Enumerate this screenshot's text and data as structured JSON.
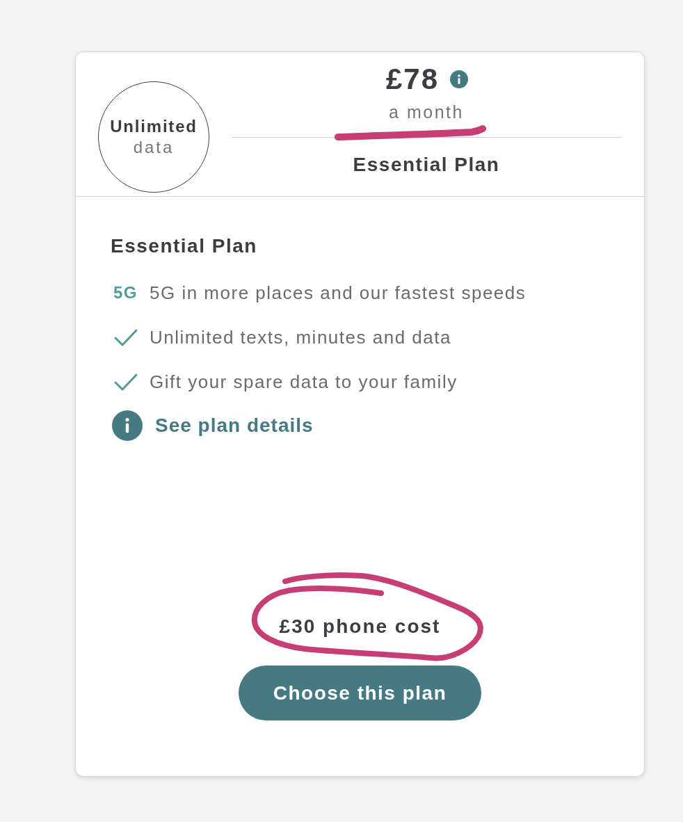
{
  "plan_card": {
    "header": {
      "data_badge": {
        "amount": "Unlimited",
        "unit": "data"
      },
      "price": "£78",
      "period": {
        "text": "a month",
        "underlined": true
      },
      "plan_name": "Essential Plan"
    },
    "title": "Essential Plan",
    "features": [
      {
        "kind": "badge",
        "badge": "5G",
        "text": "5G in more places and our fastest speeds"
      },
      {
        "kind": "check",
        "text": "Unlimited texts, minutes and data"
      },
      {
        "kind": "check",
        "text": "Gift your spare data to your family"
      }
    ],
    "details_link": "See plan details",
    "phone_cost": {
      "text": "£30 phone cost",
      "circled": true
    },
    "choose_button": "Choose this plan"
  }
}
